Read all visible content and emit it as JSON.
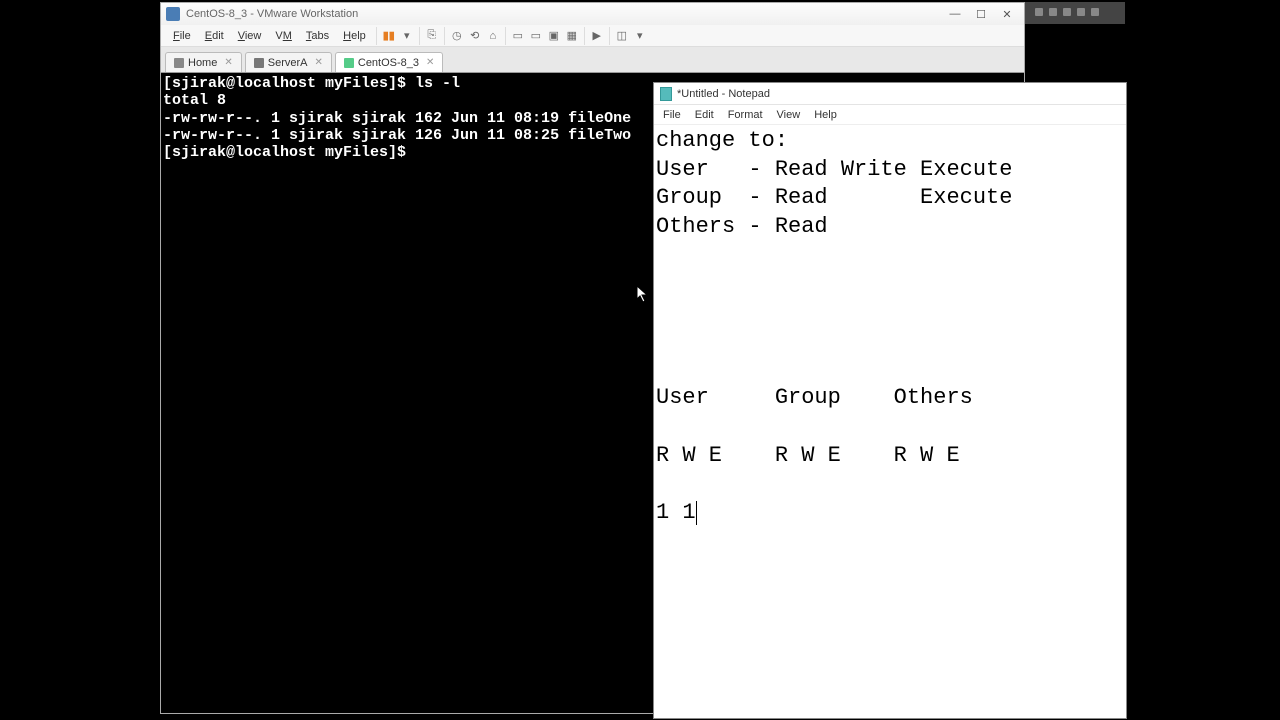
{
  "vmware": {
    "title": "CentOS-8_3 - VMware Workstation",
    "menu": [
      "File",
      "Edit",
      "View",
      "VM",
      "Tabs",
      "Help"
    ],
    "tabs": [
      {
        "label": "Home",
        "active": false,
        "iconClass": "home"
      },
      {
        "label": "ServerA",
        "active": false,
        "iconClass": ""
      },
      {
        "label": "CentOS-8_3",
        "active": true,
        "iconClass": "cent"
      }
    ]
  },
  "terminal": {
    "lines": [
      "[sjirak@localhost myFiles]$ ls -l",
      "total 8",
      "-rw-rw-r--. 1 sjirak sjirak 162 Jun 11 08:19 fileOne",
      "-rw-rw-r--. 1 sjirak sjirak 126 Jun 11 08:25 fileTwo",
      "[sjirak@localhost myFiles]$ "
    ]
  },
  "notepad": {
    "title": "*Untitled - Notepad",
    "menu": [
      "File",
      "Edit",
      "Format",
      "View",
      "Help"
    ],
    "content": "change to:\nUser   - Read Write Execute\nGroup  - Read       Execute\nOthers - Read\n\n\n\n\n\nUser     Group    Others\n\nR W E    R W E    R W E\n\n1 1"
  }
}
